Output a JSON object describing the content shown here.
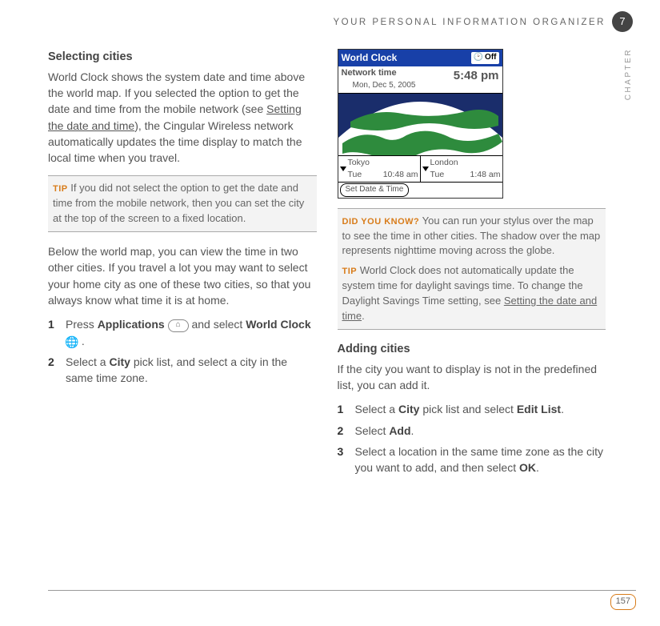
{
  "header": {
    "running_head": "YOUR PERSONAL INFORMATION ORGANIZER",
    "chapter_number": "7",
    "side_label": "CHAPTER"
  },
  "left": {
    "h_selecting": "Selecting cities",
    "p1a": "World Clock shows the system date and time above the world map. If you selected the option to get the date and time from the mobile network (see ",
    "p1_link": "Setting the date and time",
    "p1b": "), the Cingular Wireless network automatically updates the time display to match the local time when you travel.",
    "tip_label": "TIP",
    "tip_text": " If you did not select the option to get the date and time from the mobile network, then you can set the city at the top of the screen to a fixed location.",
    "p2": "Below the world map, you can view the time in two other cities. If you travel a lot you may want to select your home city as one of these two cities, so that you always know what time it is at home.",
    "steps": [
      {
        "num": "1",
        "a": "Press ",
        "b1": "Applications",
        "mid": " ",
        "post": " and select ",
        "b2": "World Clock",
        "end": " ."
      },
      {
        "num": "2",
        "a": "Select a ",
        "b1": "City",
        "post": " pick list, and select a city in the same time zone."
      }
    ]
  },
  "device": {
    "title": "World Clock",
    "off": "Off",
    "net_label": "Network time",
    "net_date": "Mon, Dec 5, 2005",
    "net_time": "5:48 pm",
    "city1": {
      "name": "Tokyo",
      "day": "Tue",
      "time": "10:48 am"
    },
    "city2": {
      "name": "London",
      "day": "Tue",
      "time": "1:48 am"
    },
    "footer_btn": "Set Date & Time"
  },
  "right": {
    "dyk_label": "DID YOU KNOW?",
    "dyk_text": "  You can run your stylus over the map to see the time in other cities. The shadow over the map represents nighttime moving across the globe.",
    "tip2_label": "TIP",
    "tip2a": " World Clock does not automatically update the system time for daylight savings time. To change the Daylight Savings Time setting, see ",
    "tip2_link": "Setting the date and time",
    "tip2b": ".",
    "h_adding": "Adding cities",
    "p_adding": "If the city you want to display is not in the predefined list, you can add it.",
    "steps": [
      {
        "num": "1",
        "a": "Select a ",
        "b1": "City",
        "mid": " pick list and select ",
        "b2": "Edit List",
        "end": "."
      },
      {
        "num": "2",
        "a": "Select ",
        "b1": "Add",
        "end": "."
      },
      {
        "num": "3",
        "a": "Select a location in the same time zone as the city you want to add, and then select ",
        "b1": "OK",
        "end": "."
      }
    ]
  },
  "footer": {
    "page": "157"
  }
}
